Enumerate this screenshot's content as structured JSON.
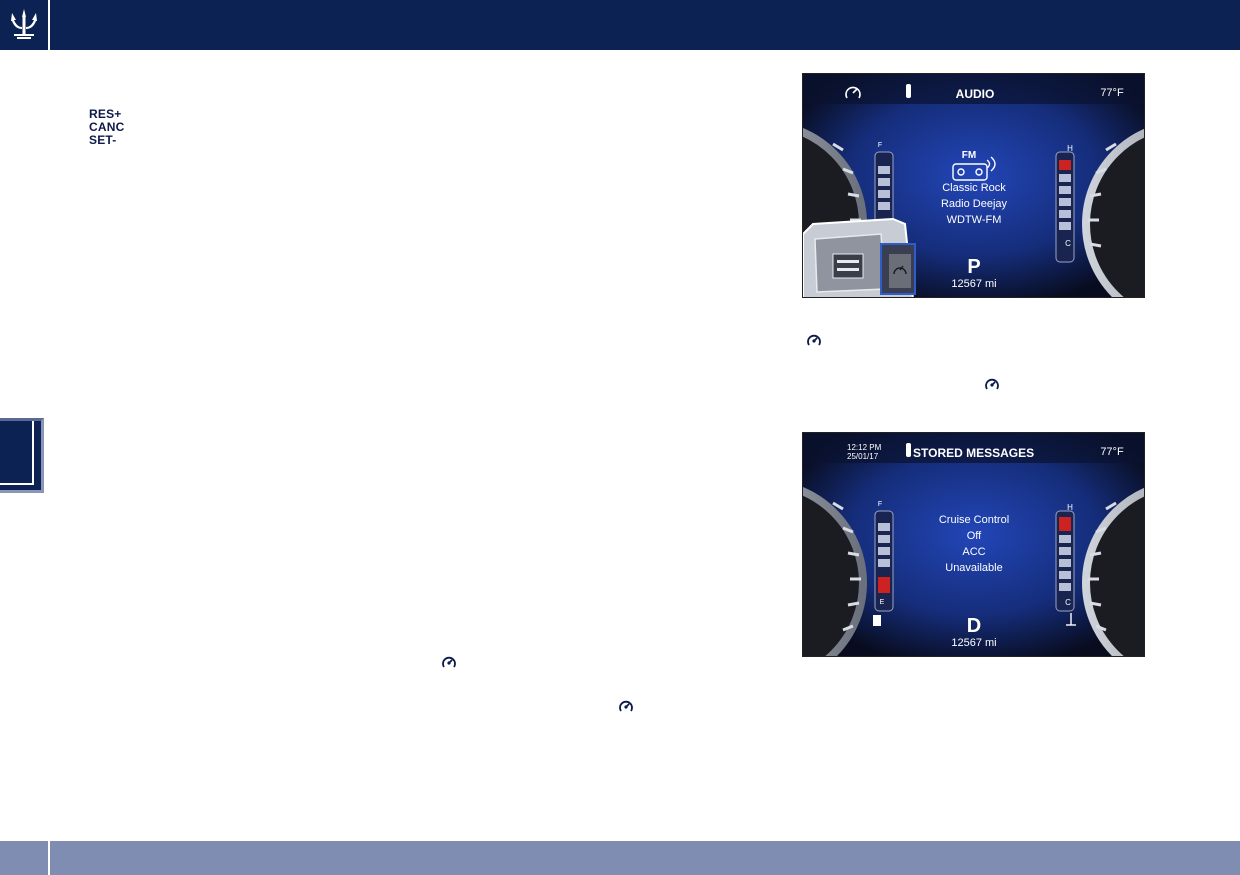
{
  "controls": {
    "items": [
      "RES+",
      "CANC",
      "SET-"
    ]
  },
  "cluster_audio": {
    "title": "AUDIO",
    "temperature": "77°F",
    "band": "FM",
    "lines": [
      "Classic Rock",
      "Radio Deejay",
      "WDTW-FM"
    ],
    "gear": "P",
    "odometer": "12567 mi",
    "fuel_top": "F",
    "temp_top": "H",
    "temp_bottom": "C"
  },
  "cluster_messages": {
    "time": "12:12 PM",
    "date": "25/01/17",
    "title": "STORED MESSAGES",
    "temperature": "77°F",
    "lines": [
      "Cruise Control",
      "Off",
      "ACC",
      "Unavailable"
    ],
    "gear": "D",
    "odometer": "12567 mi",
    "fuel_top": "F",
    "fuel_bottom": "E",
    "temp_top": "H",
    "temp_bottom": "C"
  },
  "colors": {
    "header": "#0c2253",
    "footer": "#7f8db3",
    "text": "#0d1b4a",
    "screen_blue": "#1a3ea8"
  },
  "icons": [
    "trident-logo-icon",
    "cruise-control-icon",
    "radio-icon",
    "fuel-pump-icon",
    "coolant-icon"
  ]
}
